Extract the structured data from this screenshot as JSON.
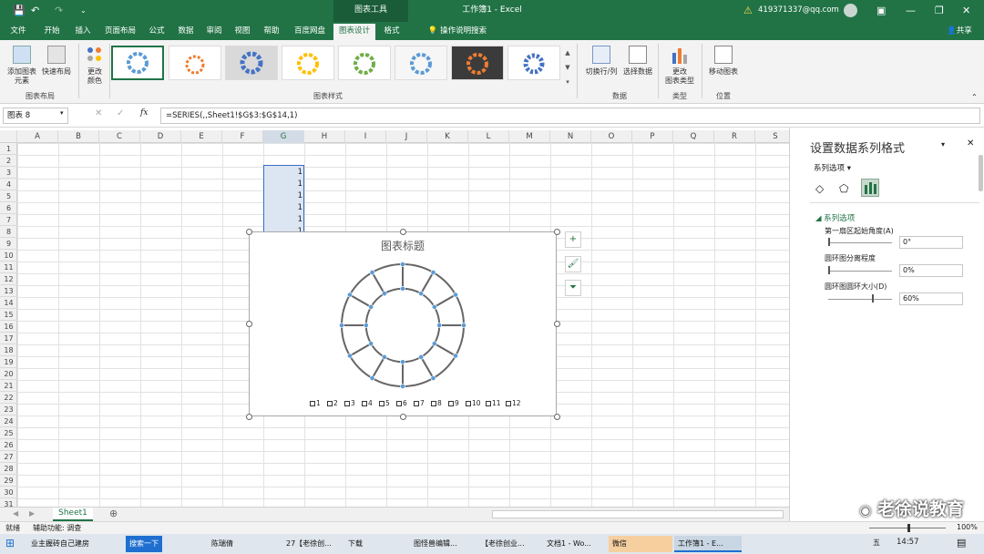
{
  "titlebar": {
    "context_tab": "图表工具",
    "title": "工作簿1 - Excel",
    "account": "419371337@qq.com"
  },
  "tabs": [
    "文件",
    "开始",
    "插入",
    "页面布局",
    "公式",
    "数据",
    "审阅",
    "视图",
    "帮助",
    "百度网盘",
    "图表设计",
    "格式"
  ],
  "tell_me": "操作说明搜索",
  "share": "共享",
  "ribbon": {
    "add_element": "添加图表\n元素",
    "quick_layout": "快速布局",
    "change_colors": "更改\n颜色",
    "switch_row_col": "切换行/列",
    "select_data": "选择数据",
    "change_type": "更改\n图表类型",
    "move_chart": "移动图表",
    "groups": [
      "图表布局",
      "图表样式",
      "数据",
      "类型",
      "位置"
    ]
  },
  "formula_bar": {
    "name_box": "图表 8",
    "fx": "fx",
    "formula": "=SERIES(,,Sheet1!$G$3:$G$14,1)"
  },
  "columns": [
    "A",
    "B",
    "C",
    "D",
    "E",
    "F",
    "G",
    "H",
    "I",
    "J",
    "K",
    "L",
    "M",
    "N",
    "O",
    "P",
    "Q",
    "R",
    "S"
  ],
  "rows": [
    "1",
    "2",
    "3",
    "4",
    "5",
    "6",
    "7",
    "8",
    "9",
    "10",
    "11",
    "12",
    "13",
    "14",
    "15",
    "16",
    "17",
    "18",
    "19",
    "20",
    "21",
    "22",
    "23",
    "24",
    "25",
    "26",
    "27",
    "28",
    "29",
    "30",
    "31"
  ],
  "g_values": [
    "1",
    "1",
    "1",
    "1",
    "1",
    "1"
  ],
  "chart": {
    "title": "图表标题",
    "legend": [
      "1",
      "2",
      "3",
      "4",
      "5",
      "6",
      "7",
      "8",
      "9",
      "10",
      "11",
      "12"
    ]
  },
  "chart_data": {
    "type": "pie",
    "subtype": "doughnut",
    "title": "图表标题",
    "categories": [
      "1",
      "2",
      "3",
      "4",
      "5",
      "6",
      "7",
      "8",
      "9",
      "10",
      "11",
      "12"
    ],
    "values": [
      1,
      1,
      1,
      1,
      1,
      1,
      1,
      1,
      1,
      1,
      1,
      1
    ],
    "hole_size": 60,
    "legend": "bottom"
  },
  "pane": {
    "title": "设置数据系列格式",
    "dropdown": "系列选项",
    "section": "系列选项",
    "field1_label": "第一扇区起始角度(A)",
    "field1_value": "0°",
    "field2_label": "圆环图分离程度",
    "field2_value": "0%",
    "field3_label": "圆环图圆环大小(D)",
    "field3_value": "60%"
  },
  "sheet_tab": "Sheet1",
  "status": {
    "ready": "就绪",
    "accessibility": "辅助功能: 调查",
    "zoom": "100%"
  },
  "watermark": "老徐说教育",
  "taskbar": {
    "items": [
      "业主握砖自己建房",
      "搜索一下",
      "陈瑞倩",
      "27【老徐创...",
      "下载",
      "图怪兽编辑...",
      "【老徐创业...",
      "文档1 - Wo...",
      "微信",
      "工作簿1 - E..."
    ],
    "time": "14:57",
    "ime": "五"
  }
}
